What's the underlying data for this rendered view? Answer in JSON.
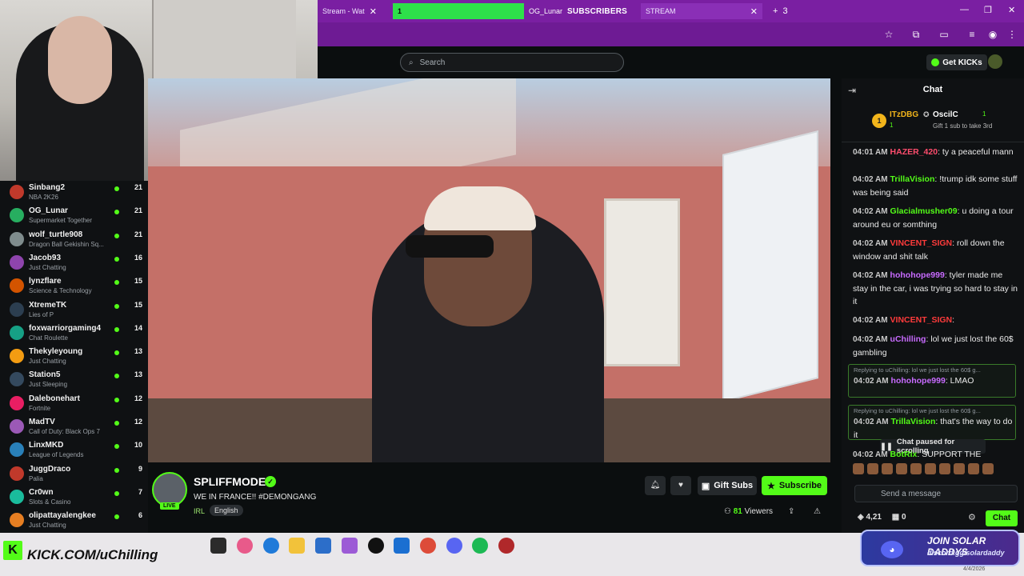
{
  "browser": {
    "tabs": [
      {
        "label": "Stream - Wat",
        "close": "✕"
      },
      {
        "label": "1",
        "close": ""
      },
      {
        "label": "OG_Lunar",
        "close": "✕"
      },
      {
        "label": "STREAM",
        "close": "✕"
      }
    ],
    "subs_banner": "SUBSCRIBERS",
    "new_tab_count": "3",
    "window_controls": [
      "—",
      "❐",
      "✕"
    ],
    "icons": [
      "star-icon",
      "extension-icon",
      "cast-icon",
      "media-icon",
      "profile-icon",
      "menu-icon"
    ]
  },
  "header": {
    "search_placeholder": "Search",
    "get_kicks": "Get KICKs"
  },
  "sidebar": {
    "items": [
      {
        "name": "Sinbang2",
        "category": "NBA 2K26",
        "viewers": "21"
      },
      {
        "name": "OG_Lunar",
        "category": "Supermarket Together",
        "viewers": "21"
      },
      {
        "name": "wolf_turtle908",
        "category": "Dragon Ball Gekishin Sq...",
        "viewers": "21"
      },
      {
        "name": "Jacob93",
        "category": "Just Chatting",
        "viewers": "16"
      },
      {
        "name": "lynzflare",
        "category": "Science & Technology",
        "viewers": "15"
      },
      {
        "name": "XtremeTK",
        "category": "Lies of P",
        "viewers": "15"
      },
      {
        "name": "foxwarriorgaming4",
        "category": "Chat Roulette",
        "viewers": "14"
      },
      {
        "name": "Thekyleyoung",
        "category": "Just Chatting",
        "viewers": "13"
      },
      {
        "name": "Station5",
        "category": "Just Sleeping",
        "viewers": "13"
      },
      {
        "name": "Dalebonehart",
        "category": "Fortnite",
        "viewers": "12"
      },
      {
        "name": "MadTV",
        "category": "Call of Duty: Black Ops 7",
        "viewers": "12"
      },
      {
        "name": "LinxMKD",
        "category": "League of Legends",
        "viewers": "10"
      },
      {
        "name": "JuggDraco",
        "category": "Palia",
        "viewers": "9"
      },
      {
        "name": "Cr0wn",
        "category": "Slots & Casino",
        "viewers": "7"
      },
      {
        "name": "olipattayalengkee",
        "category": "Just Chatting",
        "viewers": "6"
      }
    ]
  },
  "stream": {
    "streamer": "SPLIFFMODE",
    "live_badge": "LIVE",
    "title": "WE IN FRANCE!! #DEMONGANG",
    "category": "IRL",
    "language": "English",
    "gift_subs": "Gift Subs",
    "subscribe": "Subscribe",
    "viewer_count": "81",
    "viewer_label": "Viewers"
  },
  "chat": {
    "title": "Chat",
    "leaderboard": [
      {
        "rank": "1",
        "name": "ITzDBG",
        "count": "1"
      },
      {
        "rank": "",
        "name": "OscilC",
        "count": "1",
        "note": "Gift 1 sub to take 3rd"
      }
    ],
    "messages": [
      {
        "time": "04:01 AM",
        "user": "HAZER_420",
        "color": "#ff4d6d",
        "text": "ty a peaceful mann"
      },
      {
        "time": "04:02 AM",
        "user": "TrillaVision",
        "color": "#53fc18",
        "text": "!trump idk some stuff was being said"
      },
      {
        "time": "04:02 AM",
        "user": "Glacialmusher09",
        "color": "#53fc18",
        "text": "u doing a tour around eu or somthing"
      },
      {
        "time": "04:02 AM",
        "user": "VINCENT_SIGN",
        "color": "#ff3b3b",
        "text": "roll down the window and shit talk"
      },
      {
        "time": "04:02 AM",
        "user": "hohohope999",
        "color": "#c86bff",
        "text": "tyler made me stay in the car, i was trying so hard to stay in it"
      },
      {
        "time": "04:02 AM",
        "user": "VINCENT_SIGN",
        "color": "#ff3b3b",
        "text": ""
      },
      {
        "time": "04:02 AM",
        "user": "uChilling",
        "color": "#c86bff",
        "text": "lol we just lost the 60$ gambling"
      }
    ],
    "replies": [
      {
        "context": "Replying to uChilling: lol we just lost the 60$ g...",
        "time": "04:02 AM",
        "user": "hohohope999",
        "color": "#c86bff",
        "text": "LMAO"
      },
      {
        "context": "Replying to uChilling: lol we just lost the 60$ g...",
        "time": "04:02 AM",
        "user": "TrillaVision",
        "color": "#53fc18",
        "text": "that's the way to do it"
      }
    ],
    "last_message": {
      "time": "04:02 AM",
      "user": "BotRix",
      "color": "#53fc18",
      "text": "SUPPORT THE"
    },
    "paused": "Chat paused for scrolling",
    "input_placeholder": "Send a message",
    "balance": "4,21",
    "balance_b": "0",
    "send": "Chat"
  },
  "taskbar": {
    "kick_url": "KICK.COM/uChilling",
    "solar_title": "JOIN SOLAR DADDYS",
    "solar_sub": "discord.gg/solardaddy",
    "date": "4/4/2026"
  },
  "colors": {
    "accent": "#53fc18",
    "chrome": "#7a1fa2",
    "bg": "#0b0e0f"
  }
}
